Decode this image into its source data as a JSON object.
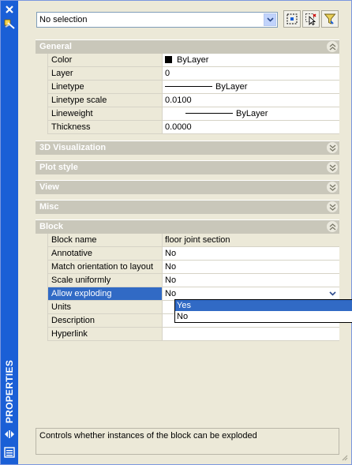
{
  "palette": {
    "title": "PROPERTIES"
  },
  "selector": {
    "value": "No selection"
  },
  "sections": {
    "general": "General",
    "visualization_3d": "3D Visualization",
    "plot_style": "Plot style",
    "view": "View",
    "misc": "Misc",
    "block": "Block"
  },
  "general": {
    "color": {
      "label": "Color",
      "value": "ByLayer"
    },
    "layer": {
      "label": "Layer",
      "value": "0"
    },
    "linetype": {
      "label": "Linetype",
      "value": "ByLayer"
    },
    "linetype_scale": {
      "label": "Linetype scale",
      "value": "0.0100"
    },
    "lineweight": {
      "label": "Lineweight",
      "value": "ByLayer"
    },
    "thickness": {
      "label": "Thickness",
      "value": "0.0000"
    }
  },
  "block": {
    "block_name": {
      "label": "Block name",
      "value": "floor joint section"
    },
    "annotative": {
      "label": "Annotative",
      "value": "No"
    },
    "match_orientation": {
      "label": "Match orientation to layout",
      "value": "No"
    },
    "scale_uniformly": {
      "label": "Scale uniformly",
      "value": "No"
    },
    "allow_exploding": {
      "label": "Allow exploding",
      "value": "No"
    },
    "units": {
      "label": "Units",
      "value": ""
    },
    "description": {
      "label": "Description",
      "value": ""
    },
    "hyperlink": {
      "label": "Hyperlink",
      "value": ""
    }
  },
  "dropdown": {
    "options": [
      "Yes",
      "No"
    ],
    "highlighted": "Yes"
  },
  "description_panel": {
    "text": "Controls whether instances of the block can be exploded"
  }
}
